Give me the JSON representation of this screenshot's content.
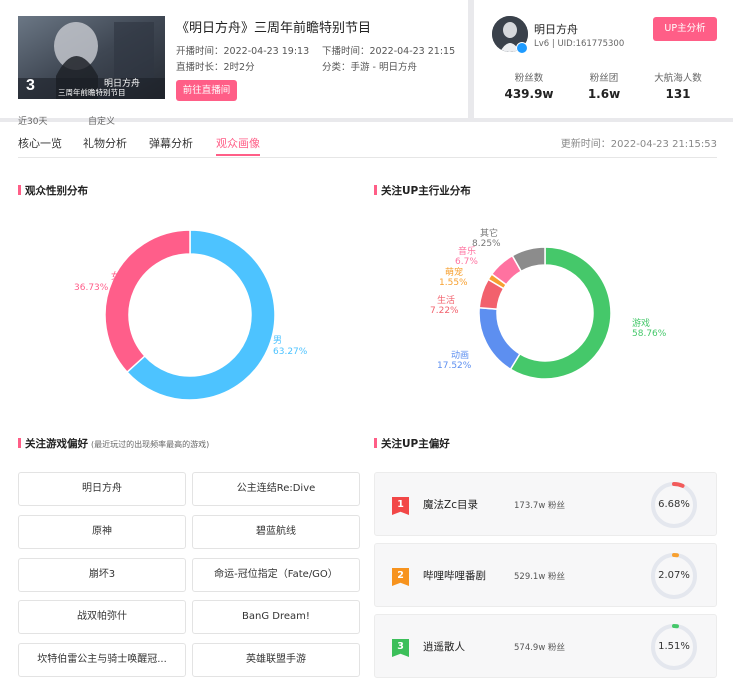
{
  "stream": {
    "title": "《明日方舟》三周年前瞻特别节目",
    "start_label": "开播时间：",
    "start_time": "2022-04-23 19:13",
    "end_label": "下播时间：",
    "end_time": "2022-04-23 21:15",
    "duration_label": "直播时长：",
    "duration": "2时2分",
    "category_label": "分类：",
    "category": "手游 - 明日方舟",
    "goto_button": "前往直播间",
    "cover_text_line1": "明日方舟",
    "cover_text_line2": "三周年前瞻特别节目"
  },
  "streamer": {
    "name": "明日方舟",
    "level_uid": "Lv6 | UID:161775300",
    "analysis_button": "UP主分析",
    "stats": [
      {
        "label": "粉丝数",
        "value": "439.9w"
      },
      {
        "label": "粉丝团",
        "value": "1.6w"
      },
      {
        "label": "大航海人数",
        "value": "131"
      }
    ]
  },
  "hidden_tabs": [
    "近30天",
    "自定义"
  ],
  "tabs": [
    {
      "label": "核心一览",
      "active": false
    },
    {
      "label": "礼物分析",
      "active": false
    },
    {
      "label": "弹幕分析",
      "active": false
    },
    {
      "label": "观众画像",
      "active": true
    }
  ],
  "update": {
    "label": "更新时间：",
    "time": "2022-04-23 21:15:53"
  },
  "gender": {
    "title": "观众性别分布",
    "chart_data": {
      "type": "pie",
      "title": "观众性别分布",
      "slices": [
        {
          "name": "男",
          "value": 63.27,
          "label": "63.27%",
          "color": "#4dc3ff"
        },
        {
          "name": "女",
          "value": 36.73,
          "label": "36.73%",
          "color": "#ff5e8a"
        }
      ]
    }
  },
  "industry": {
    "title": "关注UP主行业分布",
    "chart_data": {
      "type": "pie",
      "title": "关注UP主行业分布",
      "slices": [
        {
          "name": "游戏",
          "value": 58.76,
          "label": "58.76%",
          "color": "#45c86a"
        },
        {
          "name": "动画",
          "value": 17.52,
          "label": "17.52%",
          "color": "#5d8ff0"
        },
        {
          "name": "生活",
          "value": 7.22,
          "label": "7.22%",
          "color": "#f2616d"
        },
        {
          "name": "萌宠",
          "value": 1.55,
          "label": "1.55%",
          "color": "#f7a030"
        },
        {
          "name": "音乐",
          "value": 6.7,
          "label": "6.7%",
          "color": "#ff72a0"
        },
        {
          "name": "其它",
          "value": 8.25,
          "label": "8.25%",
          "color": "#8c8c8c"
        }
      ]
    }
  },
  "games": {
    "title": "关注游戏偏好",
    "subtitle": "(最近玩过的出现频率最高的游戏)",
    "items": [
      "明日方舟",
      "公主连结Re:Dive",
      "原神",
      "碧蓝航线",
      "崩坏3",
      "命运-冠位指定（Fate/GO）",
      "战双帕弥什",
      "BanG Dream!",
      "坎特伯雷公主与骑士唤醒冠...",
      "英雄联盟手游"
    ]
  },
  "up_pref": {
    "title": "关注UP主偏好",
    "items": [
      {
        "rank": "1",
        "name": "魔法Zc目录",
        "fans": "173.7w 粉丝",
        "percent": "6.68%",
        "ratio": 0.0668,
        "badge_color": "#f24747",
        "ring_color": "#f25b5b"
      },
      {
        "rank": "2",
        "name": "哔哩哔哩番剧",
        "fans": "529.1w 粉丝",
        "percent": "2.07%",
        "ratio": 0.0207,
        "badge_color": "#f7931e",
        "ring_color": "#f7a030"
      },
      {
        "rank": "3",
        "name": "逍遥散人",
        "fans": "574.9w 粉丝",
        "percent": "1.51%",
        "ratio": 0.0151,
        "badge_color": "#3cbf5a",
        "ring_color": "#45c86a"
      }
    ]
  }
}
